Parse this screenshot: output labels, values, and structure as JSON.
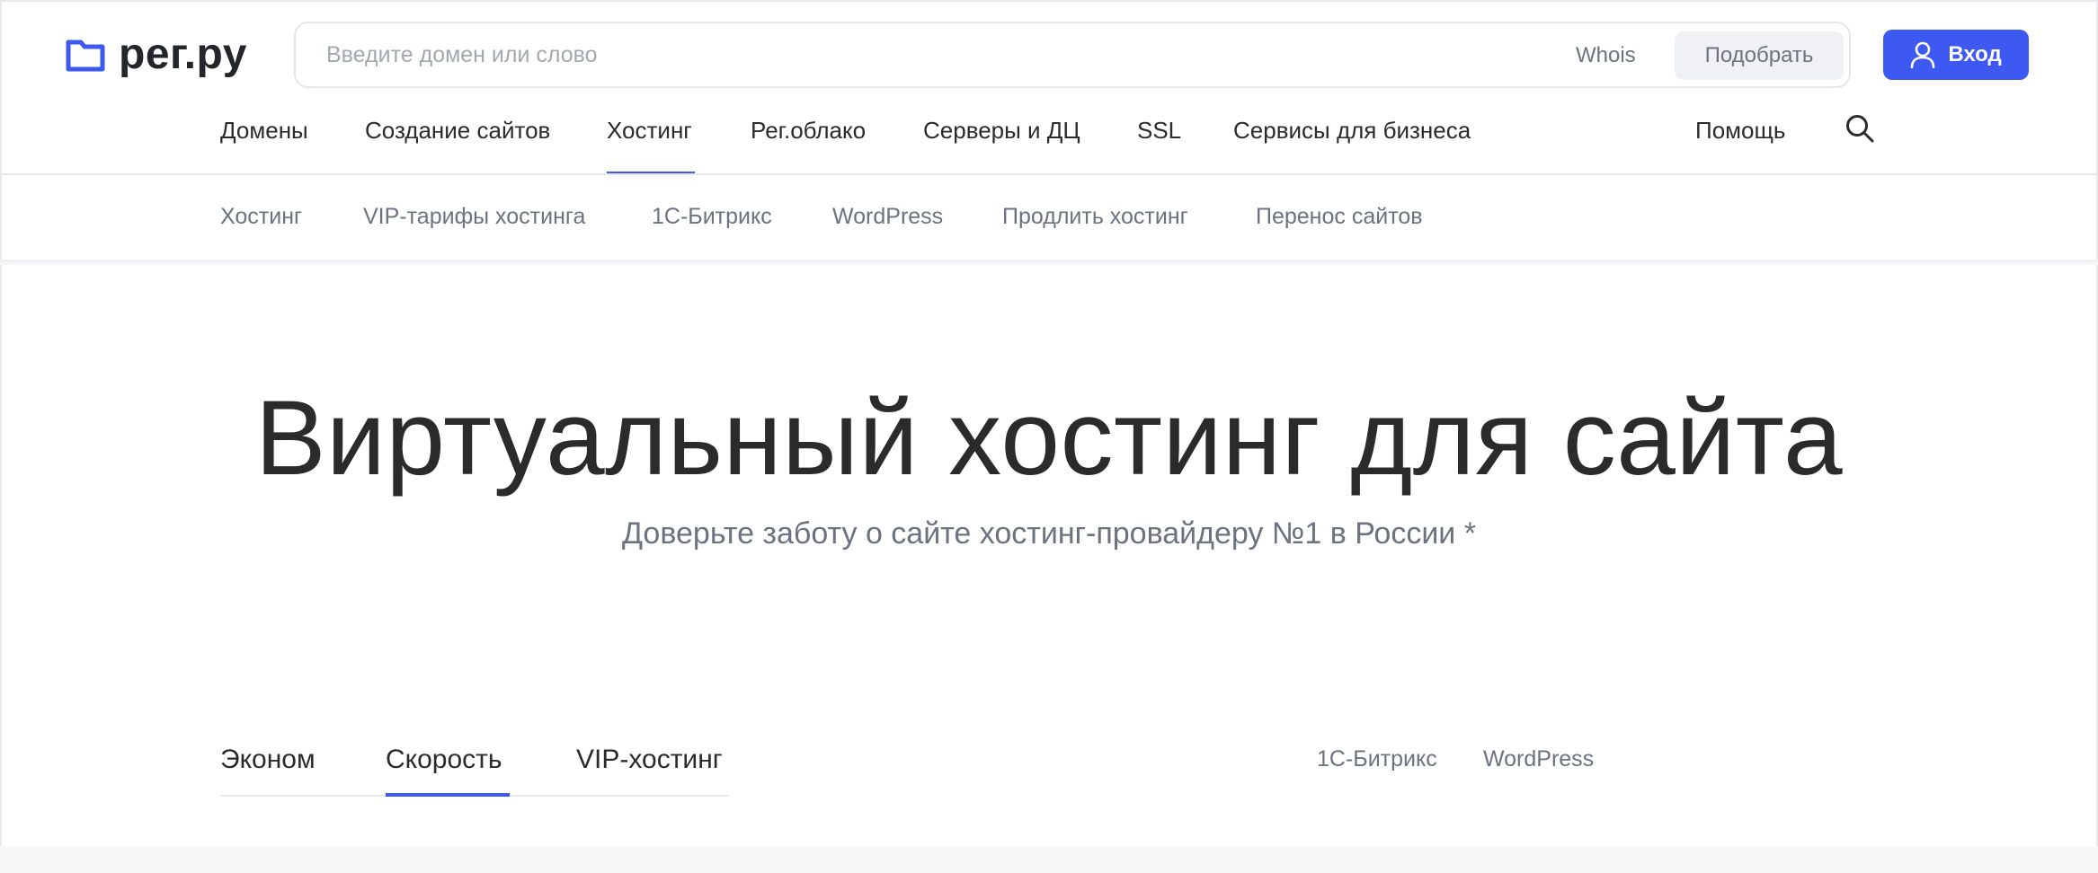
{
  "logo": {
    "text": "рег.ру",
    "icon": "folder-icon",
    "color": "#3d59f1"
  },
  "search": {
    "placeholder": "Введите домен или слово",
    "value": "",
    "whois_label": "Whois",
    "pick_label": "Подобрать"
  },
  "login": {
    "label": "Вход",
    "icon": "user-icon",
    "color": "#3d59f1"
  },
  "main_nav": {
    "items": [
      {
        "label": "Домены"
      },
      {
        "label": "Создание сайтов"
      },
      {
        "label": "Хостинг",
        "active": true
      },
      {
        "label": "Рег.облако"
      },
      {
        "label": "Серверы и ДЦ"
      },
      {
        "label": "SSL"
      },
      {
        "label": "Сервисы для бизнеса"
      }
    ],
    "help_label": "Помощь",
    "search_icon": "search-icon"
  },
  "sub_nav": {
    "items": [
      {
        "label": "Хостинг"
      },
      {
        "label": "VIP-тарифы хостинга"
      },
      {
        "label": "1С-Битрикс"
      },
      {
        "label": "WordPress"
      },
      {
        "label": "Продлить хостинг"
      },
      {
        "label": "Перенос сайтов"
      }
    ]
  },
  "hero": {
    "title": "Виртуальный хостинг для сайта",
    "subtitle": "Доверьте заботу о сайте хостинг-провайдеру №1 в России *"
  },
  "plan_tabs": {
    "items": [
      {
        "label": "Эконом"
      },
      {
        "label": "Скорость",
        "active": true
      },
      {
        "label": "VIP-хостинг"
      }
    ],
    "platforms": [
      {
        "label": "1С-Битрикс"
      },
      {
        "label": "WordPress"
      }
    ]
  }
}
